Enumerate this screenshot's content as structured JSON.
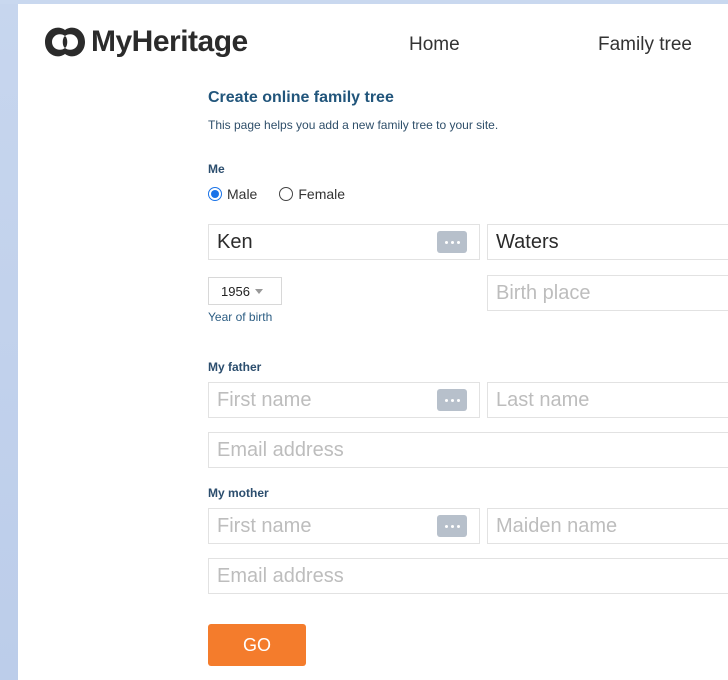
{
  "header": {
    "logo_text": "MyHeritage",
    "nav": [
      "Home",
      "Family tree"
    ]
  },
  "form": {
    "title": "Create online family tree",
    "subtitle": "This page helps you add a new family tree to your site.",
    "me": {
      "label": "Me",
      "gender_options": [
        "Male",
        "Female"
      ],
      "gender_selected": "Male",
      "first_name": "Ken",
      "last_name": "Waters",
      "year_of_birth": "1956",
      "year_label": "Year of birth",
      "birth_place_placeholder": "Birth place"
    },
    "father": {
      "label": "My father",
      "first_name_placeholder": "First name",
      "last_name_placeholder": "Last name",
      "email_placeholder": "Email address"
    },
    "mother": {
      "label": "My mother",
      "first_name_placeholder": "First name",
      "maiden_name_placeholder": "Maiden name",
      "email_placeholder": "Email address"
    },
    "submit_label": "GO"
  },
  "colors": {
    "title": "#21557b",
    "accent_button": "#f47c2c",
    "radio_checked": "#1a73e8",
    "sidebar": "#c7d6ee"
  }
}
